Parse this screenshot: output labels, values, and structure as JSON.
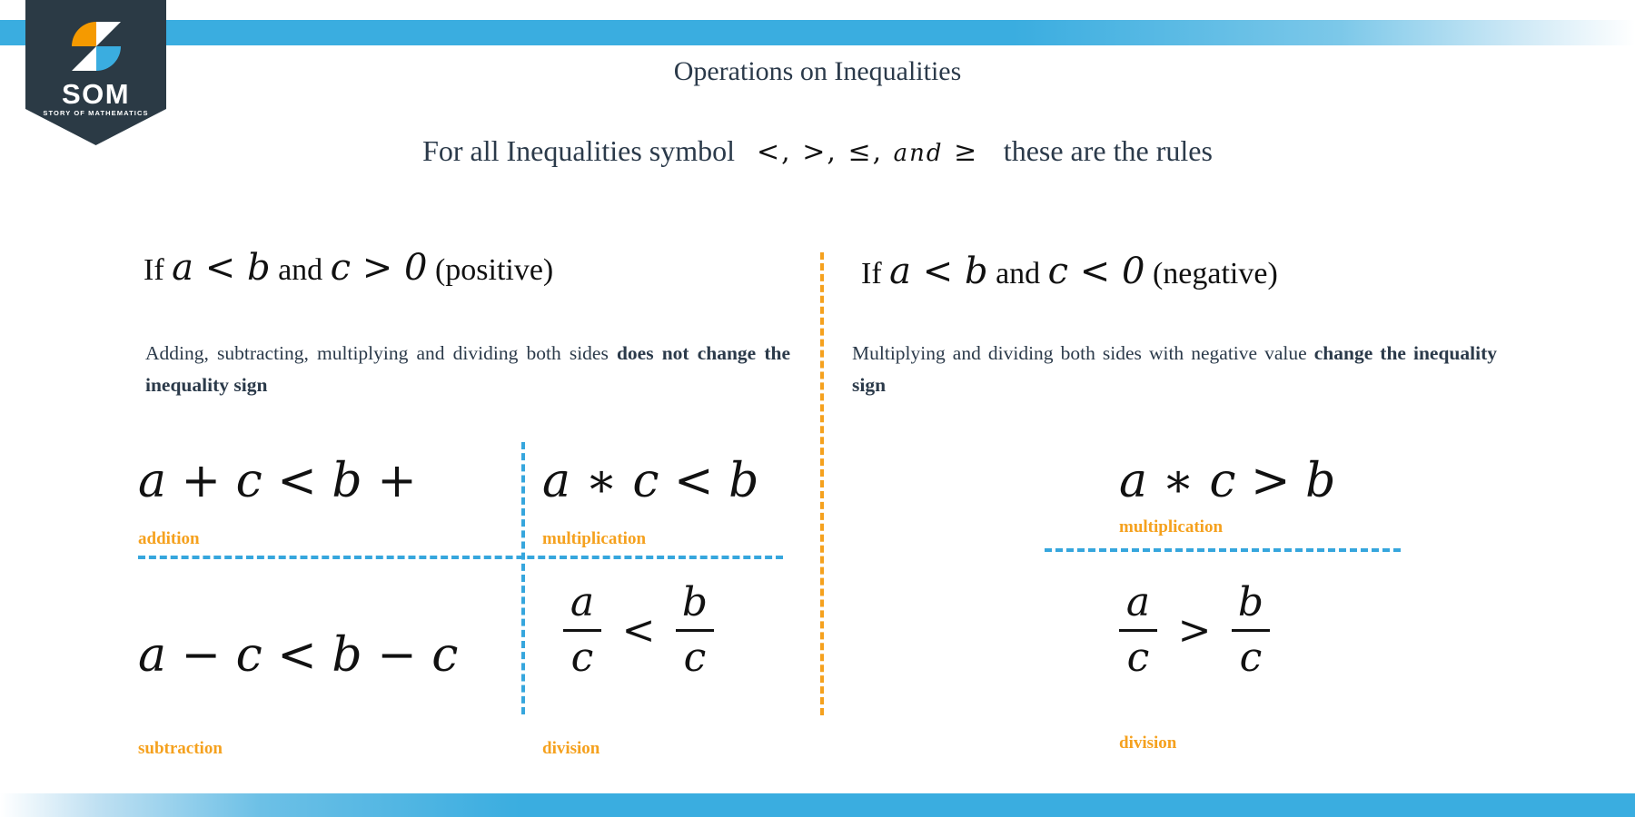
{
  "brand": {
    "name": "SOM",
    "tagline": "STORY OF MATHEMATICS",
    "logo_icon": "som-s-mark-icon",
    "ribbon_color": "#2b3a45",
    "orange": "#f5a11e",
    "blue": "#3aade0"
  },
  "header": {
    "title": "Operations on Inequalities",
    "subtitle_lead": "For all Inequalities symbol",
    "subtitle_symbols_pre": "<, >, ≤,",
    "subtitle_symbols_and": "and",
    "subtitle_symbols_post": "≥",
    "subtitle_trail": "these are the rules"
  },
  "columns": [
    {
      "id": "positive",
      "heading_if": "If",
      "heading_expr_left": "a < b",
      "heading_and": "and",
      "heading_expr_right": "c > 0",
      "heading_note": "(positive)",
      "paragraph_plain": "Adding, subtracting, multiplying and dividing both sides ",
      "paragraph_bold": "does not change the inequality sign",
      "cells": [
        {
          "expression": "a + c < b +",
          "caption": "addition"
        },
        {
          "expression": "a ∗ c < b",
          "caption": "multiplication"
        },
        {
          "expression": "a − c < b − c",
          "caption": "subtraction"
        },
        {
          "fraction_left_num": "a",
          "fraction_left_den": "c",
          "relation": "<",
          "fraction_right_num": "b",
          "fraction_right_den": "c",
          "caption": "division"
        }
      ]
    },
    {
      "id": "negative",
      "heading_if": "If",
      "heading_expr_left": "a < b",
      "heading_and": "and",
      "heading_expr_right": "c < 0",
      "heading_note": "(negative)",
      "paragraph_plain": "Multiplying and dividing both sides with negative value ",
      "paragraph_bold": "change the inequality sign",
      "cells": [
        {
          "expression": "a ∗ c > b",
          "caption": "multiplication"
        },
        {
          "fraction_left_num": "a",
          "fraction_left_den": "c",
          "relation": ">",
          "fraction_right_num": "b",
          "fraction_right_den": "c",
          "caption": "division"
        }
      ]
    }
  ]
}
